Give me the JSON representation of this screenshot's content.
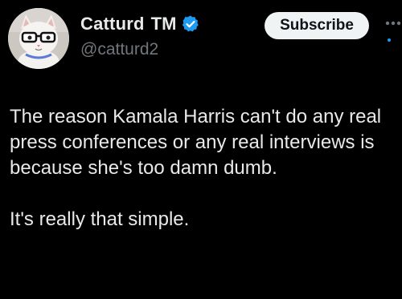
{
  "author": {
    "display_name": "Catturd",
    "tm_mark": "TM",
    "handle": "@catturd2",
    "verified_badge_icon": "verified-badge-icon"
  },
  "actions": {
    "subscribe_label": "Subscribe",
    "more_icon": "more-options-icon"
  },
  "tweet": {
    "paragraph_1": "The reason Kamala Harris can't do any real press conferences or any real interviews is because she's too damn dumb.",
    "paragraph_2": "It's really that simple."
  },
  "colors": {
    "background": "#000000",
    "text_primary": "#e7e9ea",
    "text_secondary": "#71767b",
    "verified_blue": "#1d9bf0",
    "button_bg": "#eff3f4",
    "button_text": "#0f1419"
  }
}
